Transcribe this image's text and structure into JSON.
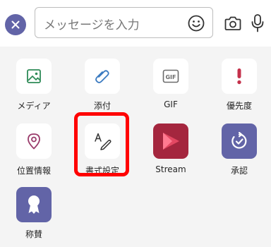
{
  "compose": {
    "placeholder": "メッセージを入力"
  },
  "apps": [
    {
      "label": "メディア",
      "icon": "image-icon"
    },
    {
      "label": "添付",
      "icon": "paperclip-icon"
    },
    {
      "label": "GIF",
      "icon": "gif-icon"
    },
    {
      "label": "優先度",
      "icon": "exclamation-icon"
    },
    {
      "label": "位置情報",
      "icon": "location-pin-icon"
    },
    {
      "label": "書式設定",
      "icon": "format-text-icon"
    },
    {
      "label": "Stream",
      "icon": "stream-icon"
    },
    {
      "label": "承認",
      "icon": "approval-icon"
    },
    {
      "label": "称賛",
      "icon": "praise-badge-icon"
    }
  ],
  "colors": {
    "accent": "#6264a7",
    "stream": "#a4263e",
    "priority": "#c4314b",
    "highlight": "#ff0000"
  }
}
